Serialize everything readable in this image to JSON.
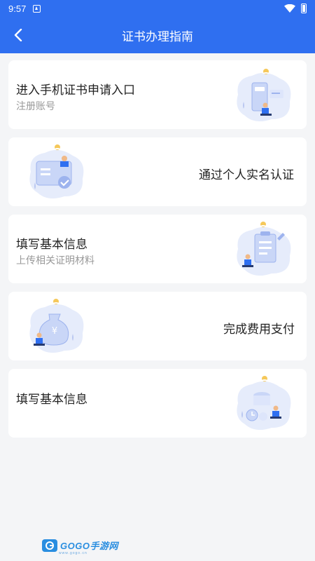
{
  "status_bar": {
    "time": "9:57"
  },
  "header": {
    "title": "证书办理指南",
    "back_icon": "chevron-left-icon"
  },
  "steps": [
    {
      "title": "进入手机证书申请入口",
      "subtitle": "注册账号",
      "illustration": "phone-registration-illustration"
    },
    {
      "title": "通过个人实名认证",
      "subtitle": "",
      "illustration": "id-verification-illustration"
    },
    {
      "title": "填写基本信息",
      "subtitle": "上传相关证明材料",
      "illustration": "clipboard-form-illustration"
    },
    {
      "title": "完成费用支付",
      "subtitle": "",
      "illustration": "money-bag-illustration"
    },
    {
      "title": "填写基本信息",
      "subtitle": "",
      "illustration": "certificate-processing-illustration"
    }
  ],
  "watermark": {
    "text": "GOGO手游网",
    "sub": "www.gogo.cn"
  },
  "colors": {
    "primary": "#2f6ff0",
    "background": "#f4f5f7",
    "card": "#ffffff",
    "title_text": "#222222",
    "subtitle_text": "#999999"
  }
}
